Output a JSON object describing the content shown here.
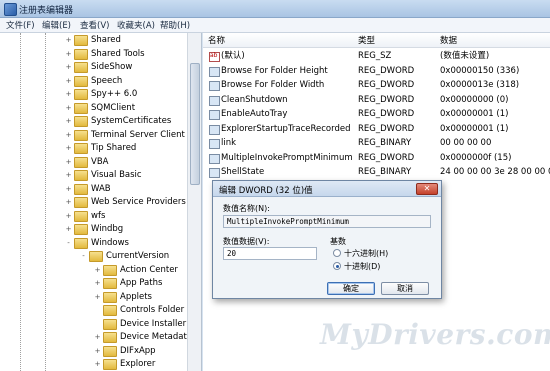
{
  "window": {
    "title": "注册表编辑器"
  },
  "menu": [
    "文件(F)",
    "编辑(E)",
    "查看(V)",
    "收藏夹(A)",
    "帮助(H)"
  ],
  "tree": {
    "items": [
      {
        "label": "Shared",
        "level": 0,
        "expander": "+"
      },
      {
        "label": "Shared Tools",
        "level": 0,
        "expander": "+"
      },
      {
        "label": "SideShow",
        "level": 0,
        "expander": "+"
      },
      {
        "label": "Speech",
        "level": 0,
        "expander": "+"
      },
      {
        "label": "Spy++ 6.0",
        "level": 0,
        "expander": "+"
      },
      {
        "label": "SQMClient",
        "level": 0,
        "expander": "+"
      },
      {
        "label": "SystemCertificates",
        "level": 0,
        "expander": "+"
      },
      {
        "label": "Terminal Server Client",
        "level": 0,
        "expander": "+"
      },
      {
        "label": "Tip Shared",
        "level": 0,
        "expander": "+"
      },
      {
        "label": "VBA",
        "level": 0,
        "expander": "+"
      },
      {
        "label": "Visual Basic",
        "level": 0,
        "expander": "+"
      },
      {
        "label": "WAB",
        "level": 0,
        "expander": "+"
      },
      {
        "label": "Web Service Providers",
        "level": 0,
        "expander": "+"
      },
      {
        "label": "wfs",
        "level": 0,
        "expander": "+"
      },
      {
        "label": "Windbg",
        "level": 0,
        "expander": "+"
      },
      {
        "label": "Windows",
        "level": 0,
        "expander": "-"
      },
      {
        "label": "CurrentVersion",
        "level": 1,
        "expander": "-"
      },
      {
        "label": "Action Center",
        "level": 2,
        "expander": "+"
      },
      {
        "label": "App Paths",
        "level": 2,
        "expander": "+"
      },
      {
        "label": "Applets",
        "level": 2,
        "expander": "+"
      },
      {
        "label": "Controls Folder",
        "level": 2,
        "expander": ""
      },
      {
        "label": "Device Installer",
        "level": 2,
        "expander": ""
      },
      {
        "label": "Device Metadata",
        "level": 2,
        "expander": "+"
      },
      {
        "label": "DIFxApp",
        "level": 2,
        "expander": "+"
      },
      {
        "label": "Explorer",
        "level": 2,
        "expander": "+"
      }
    ]
  },
  "list": {
    "headers": {
      "name": "名称",
      "type": "类型",
      "data": "数据"
    },
    "rows": [
      {
        "name": "(默认)",
        "type": "REG_SZ",
        "data": "(数值未设置)",
        "icon": "string-value-icon"
      },
      {
        "name": "Browse For Folder Height",
        "type": "REG_DWORD",
        "data": "0x00000150 (336)",
        "icon": "binary-value-icon"
      },
      {
        "name": "Browse For Folder Width",
        "type": "REG_DWORD",
        "data": "0x0000013e (318)",
        "icon": "binary-value-icon"
      },
      {
        "name": "CleanShutdown",
        "type": "REG_DWORD",
        "data": "0x00000000 (0)",
        "icon": "binary-value-icon"
      },
      {
        "name": "EnableAutoTray",
        "type": "REG_DWORD",
        "data": "0x00000001 (1)",
        "icon": "binary-value-icon"
      },
      {
        "name": "ExplorerStartupTraceRecorded",
        "type": "REG_DWORD",
        "data": "0x00000001 (1)",
        "icon": "binary-value-icon"
      },
      {
        "name": "link",
        "type": "REG_BINARY",
        "data": "00 00 00 00",
        "icon": "binary-value-icon"
      },
      {
        "name": "MultipleInvokePromptMinimum",
        "type": "REG_DWORD",
        "data": "0x0000000f (15)",
        "icon": "binary-value-icon"
      },
      {
        "name": "ShellState",
        "type": "REG_BINARY",
        "data": "24 00 00 00 3e 28 00 00 00 0",
        "icon": "binary-value-icon"
      }
    ]
  },
  "dialog": {
    "title": "编辑 DWORD (32 位)值",
    "close_label": "✕",
    "name_label": "数值名称(N):",
    "name_value": "MultipleInvokePromptMinimum",
    "data_label": "数值数据(V):",
    "data_value": "20",
    "base_label": "基数",
    "hex_label": "十六进制(H)",
    "dec_label": "十进制(D)",
    "selected_base": "decimal",
    "ok_label": "确定",
    "cancel_label": "取消"
  },
  "watermark": "MyDrivers.com"
}
